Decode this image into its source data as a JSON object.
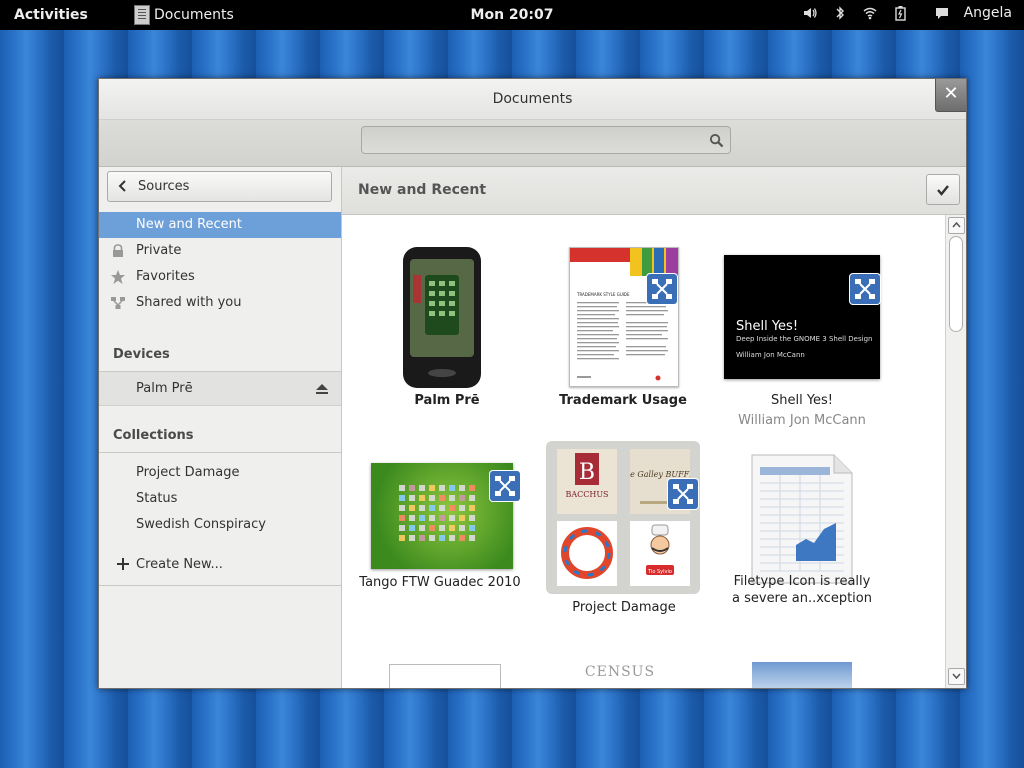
{
  "topbar": {
    "activities": "Activities",
    "app_name": "Documents",
    "clock": "Mon 20:07",
    "user": "Angela"
  },
  "window": {
    "title": "Documents",
    "close_glyph": "✕"
  },
  "search": {
    "value": "",
    "placeholder": ""
  },
  "sidebar": {
    "sources_label": "Sources",
    "items": [
      {
        "label": "New and Recent",
        "icon": "none"
      },
      {
        "label": "Private",
        "icon": "lock-icon"
      },
      {
        "label": "Favorites",
        "icon": "star-icon"
      },
      {
        "label": "Shared with you",
        "icon": "share-icon"
      }
    ],
    "devices_heading": "Devices",
    "devices": [
      {
        "label": "Palm Prē"
      }
    ],
    "collections_heading": "Collections",
    "collections": [
      {
        "label": "Project Damage"
      },
      {
        "label": "Status"
      },
      {
        "label": "Swedish Conspiracy"
      }
    ],
    "create_new": "Create New..."
  },
  "main": {
    "title": "New and Recent",
    "items": [
      {
        "title": "Palm Prē",
        "subtitle": ""
      },
      {
        "title": "Trademark Usage",
        "subtitle": ""
      },
      {
        "title": "Shell Yes!",
        "subtitle": "William Jon McCann"
      },
      {
        "title": "Tango FTW Guadec 2010",
        "subtitle": ""
      },
      {
        "title": "Project Damage",
        "subtitle": ""
      },
      {
        "title": "Filetype Icon is really",
        "subtitle": "a severe an..xception"
      }
    ],
    "shell_thumb": {
      "heading": "Shell Yes!",
      "sub": "Deep Inside the GNOME 3 Shell Design",
      "author": "William Jon McCann"
    },
    "trademark_thumb_heading": "TRADEMARK STYLE GUIDE",
    "collage_labels": [
      "BACCHUS",
      "The Galley BUFFET",
      "Tio Sylvio"
    ],
    "census_text": "CENSUS"
  },
  "colors": {
    "selected": "#6d9fd9",
    "badge": "#3a6fb8"
  }
}
